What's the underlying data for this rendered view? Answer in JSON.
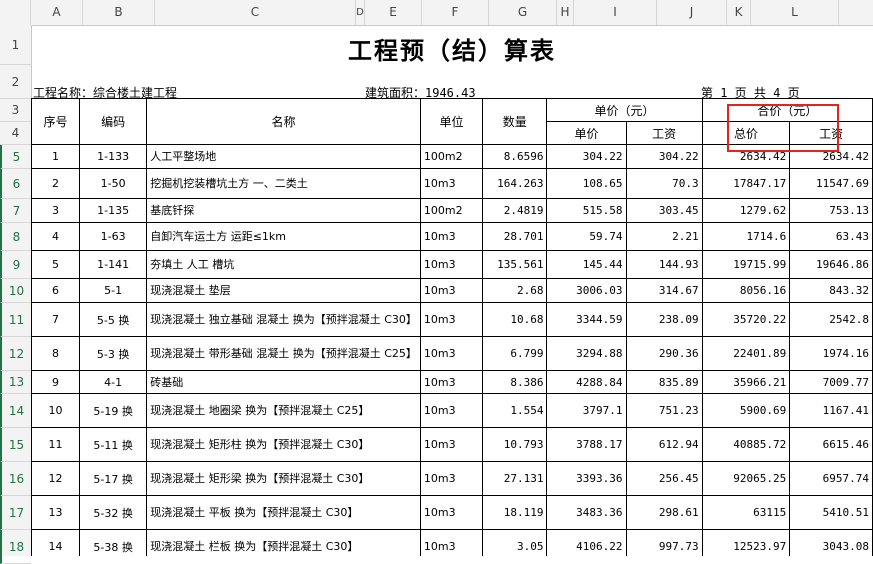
{
  "columns": [
    "A",
    "B",
    "C",
    "D",
    "E",
    "F",
    "G",
    "H",
    "I",
    "J",
    "K",
    "L"
  ],
  "rows": [
    "1",
    "2",
    "3",
    "4",
    "5",
    "6",
    "7",
    "8",
    "9",
    "10",
    "11",
    "12",
    "13",
    "14",
    "15",
    "16",
    "17",
    "18"
  ],
  "sheet": {
    "title": "工程预（结）算表",
    "project_label": "工程名称：综合楼土建工程",
    "area_label": "建筑面积：1946.43",
    "page_info": "第   1   页   共   4   页"
  },
  "headers": {
    "seq": "序号",
    "code": "编码",
    "name": "名称",
    "unit": "单位",
    "qty": "数量",
    "unit_price_group": "单价（元）",
    "unit_price": "单价",
    "unit_wage": "工资",
    "total_group": "合价（元）",
    "total_price": "总价",
    "total_wage": "工资"
  },
  "items": [
    {
      "seq": "1",
      "code": "1-133",
      "name": "人工平整场地",
      "unit": "100m2",
      "qty": "8.6596",
      "price": "304.22",
      "wage": "304.22",
      "total": "2634.42",
      "total_wage": "2634.42"
    },
    {
      "seq": "2",
      "code": "1-50",
      "name": "挖掘机挖装槽坑土方 一、二类土",
      "unit": "10m3",
      "qty": "164.263",
      "price": "108.65",
      "wage": "70.3",
      "total": "17847.17",
      "total_wage": "11547.69"
    },
    {
      "seq": "3",
      "code": "1-135",
      "name": "基底钎探",
      "unit": "100m2",
      "qty": "2.4819",
      "price": "515.58",
      "wage": "303.45",
      "total": "1279.62",
      "total_wage": "753.13"
    },
    {
      "seq": "4",
      "code": "1-63",
      "name": "自卸汽车运土方 运距≤1km",
      "unit": "10m3",
      "qty": "28.701",
      "price": "59.74",
      "wage": "2.21",
      "total": "1714.6",
      "total_wage": "63.43"
    },
    {
      "seq": "5",
      "code": "1-141",
      "name": "夯填土 人工 槽坑",
      "unit": "10m3",
      "qty": "135.561",
      "price": "145.44",
      "wage": "144.93",
      "total": "19715.99",
      "total_wage": "19646.86"
    },
    {
      "seq": "6",
      "code": "5-1",
      "name": "现浇混凝土 垫层",
      "unit": "10m3",
      "qty": "2.68",
      "price": "3006.03",
      "wage": "314.67",
      "total": "8056.16",
      "total_wage": "843.32"
    },
    {
      "seq": "7",
      "code": "5-5 换",
      "name": "现浇混凝土 独立基础 混凝土  换为【预拌混凝土 C30】",
      "unit": "10m3",
      "qty": "10.68",
      "price": "3344.59",
      "wage": "238.09",
      "total": "35720.22",
      "total_wage": "2542.8"
    },
    {
      "seq": "8",
      "code": "5-3 换",
      "name": "现浇混凝土 带形基础 混凝土  换为【预拌混凝土 C25】",
      "unit": "10m3",
      "qty": "6.799",
      "price": "3294.88",
      "wage": "290.36",
      "total": "22401.89",
      "total_wage": "1974.16"
    },
    {
      "seq": "9",
      "code": "4-1",
      "name": "砖基础",
      "unit": "10m3",
      "qty": "8.386",
      "price": "4288.84",
      "wage": "835.89",
      "total": "35966.21",
      "total_wage": "7009.77"
    },
    {
      "seq": "10",
      "code": "5-19 换",
      "name": "现浇混凝土 地圈梁  换为【预拌混凝土 C25】",
      "unit": "10m3",
      "qty": "1.554",
      "price": "3797.1",
      "wage": "751.23",
      "total": "5900.69",
      "total_wage": "1167.41"
    },
    {
      "seq": "11",
      "code": "5-11 换",
      "name": "现浇混凝土 矩形柱  换为【预拌混凝土 C30】",
      "unit": "10m3",
      "qty": "10.793",
      "price": "3788.17",
      "wage": "612.94",
      "total": "40885.72",
      "total_wage": "6615.46"
    },
    {
      "seq": "12",
      "code": "5-17 换",
      "name": "现浇混凝土 矩形梁  换为【预拌混凝土 C30】",
      "unit": "10m3",
      "qty": "27.131",
      "price": "3393.36",
      "wage": "256.45",
      "total": "92065.25",
      "total_wage": "6957.74"
    },
    {
      "seq": "13",
      "code": "5-32 换",
      "name": "现浇混凝土 平板  换为【预拌混凝土 C30】",
      "unit": "10m3",
      "qty": "18.119",
      "price": "3483.36",
      "wage": "298.61",
      "total": "63115",
      "total_wage": "5410.51"
    },
    {
      "seq": "14",
      "code": "5-38 换",
      "name": "现浇混凝土 栏板  换为【预拌混凝土 C30】",
      "unit": "10m3",
      "qty": "3.05",
      "price": "4106.22",
      "wage": "997.73",
      "total": "12523.97",
      "total_wage": "3043.08"
    }
  ]
}
